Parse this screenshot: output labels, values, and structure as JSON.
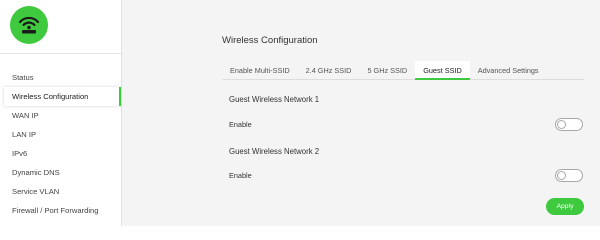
{
  "sidebar": {
    "logo_icon": "wifi-router-icon",
    "items": [
      {
        "label": "Status"
      },
      {
        "label": "Wireless Configuration",
        "active": true
      },
      {
        "label": "WAN IP"
      },
      {
        "label": "LAN IP"
      },
      {
        "label": "IPv6"
      },
      {
        "label": "Dynamic DNS"
      },
      {
        "label": "Service VLAN"
      },
      {
        "label": "Firewall / Port Forwarding"
      }
    ]
  },
  "main": {
    "title": "Wireless Configuration",
    "tabs": [
      {
        "label": "Enable Multi-SSID"
      },
      {
        "label": "2.4 GHz SSID"
      },
      {
        "label": "5 GHz SSID"
      },
      {
        "label": "Guest SSID",
        "active": true
      },
      {
        "label": "Advanced Settings"
      }
    ],
    "sections": [
      {
        "title": "Guest Wireless Network 1",
        "field_label": "Enable",
        "enabled": false
      },
      {
        "title": "Guest Wireless Network 2",
        "field_label": "Enable",
        "enabled": false
      }
    ],
    "apply_label": "Apply"
  },
  "colors": {
    "accent": "#3ec93e",
    "background": "#f4f4f4",
    "sidebar": "#ffffff"
  }
}
